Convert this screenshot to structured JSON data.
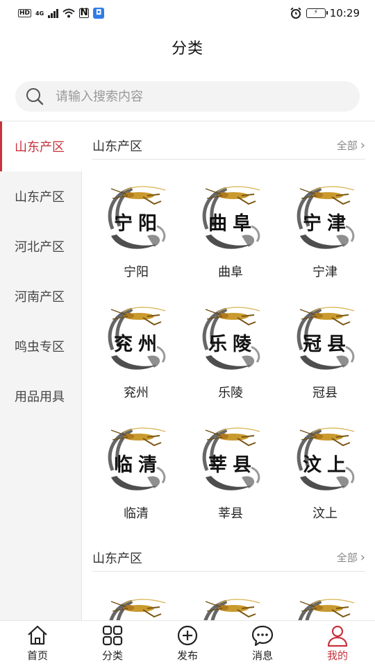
{
  "status_bar": {
    "hd": "HD",
    "network": "4G",
    "nfc": "N",
    "time": "10:29"
  },
  "header": {
    "title": "分类"
  },
  "search": {
    "placeholder": "请输入搜索内容"
  },
  "sidebar": {
    "items": [
      {
        "label": "山东产区",
        "active": true
      },
      {
        "label": "山东产区",
        "active": false
      },
      {
        "label": "河北产区",
        "active": false
      },
      {
        "label": "河南产区",
        "active": false
      },
      {
        "label": "鸣虫专区",
        "active": false
      },
      {
        "label": "用品用具",
        "active": false
      }
    ]
  },
  "sections": [
    {
      "title": "山东产区",
      "more_label": "全部",
      "items": [
        {
          "badge": "宁阳",
          "label": "宁阳"
        },
        {
          "badge": "曲阜",
          "label": "曲阜"
        },
        {
          "badge": "宁津",
          "label": "宁津"
        },
        {
          "badge": "兖州",
          "label": "兖州"
        },
        {
          "badge": "乐陵",
          "label": "乐陵"
        },
        {
          "badge": "冠县",
          "label": "冠县"
        },
        {
          "badge": "临清",
          "label": "临清"
        },
        {
          "badge": "莘县",
          "label": "莘县"
        },
        {
          "badge": "汶上",
          "label": "汶上"
        }
      ]
    },
    {
      "title": "山东产区",
      "more_label": "全部"
    }
  ],
  "tab_bar": {
    "tabs": [
      {
        "label": "首页",
        "icon": "home-icon"
      },
      {
        "label": "分类",
        "icon": "grid-icon"
      },
      {
        "label": "发布",
        "icon": "plus-circle-icon"
      },
      {
        "label": "消息",
        "icon": "chat-icon"
      },
      {
        "label": "我的",
        "icon": "user-icon",
        "active": true
      }
    ]
  },
  "colors": {
    "accent": "#c8323c",
    "sidebar_bg": "#f4f4f4",
    "search_bg": "#f3f3f3"
  }
}
